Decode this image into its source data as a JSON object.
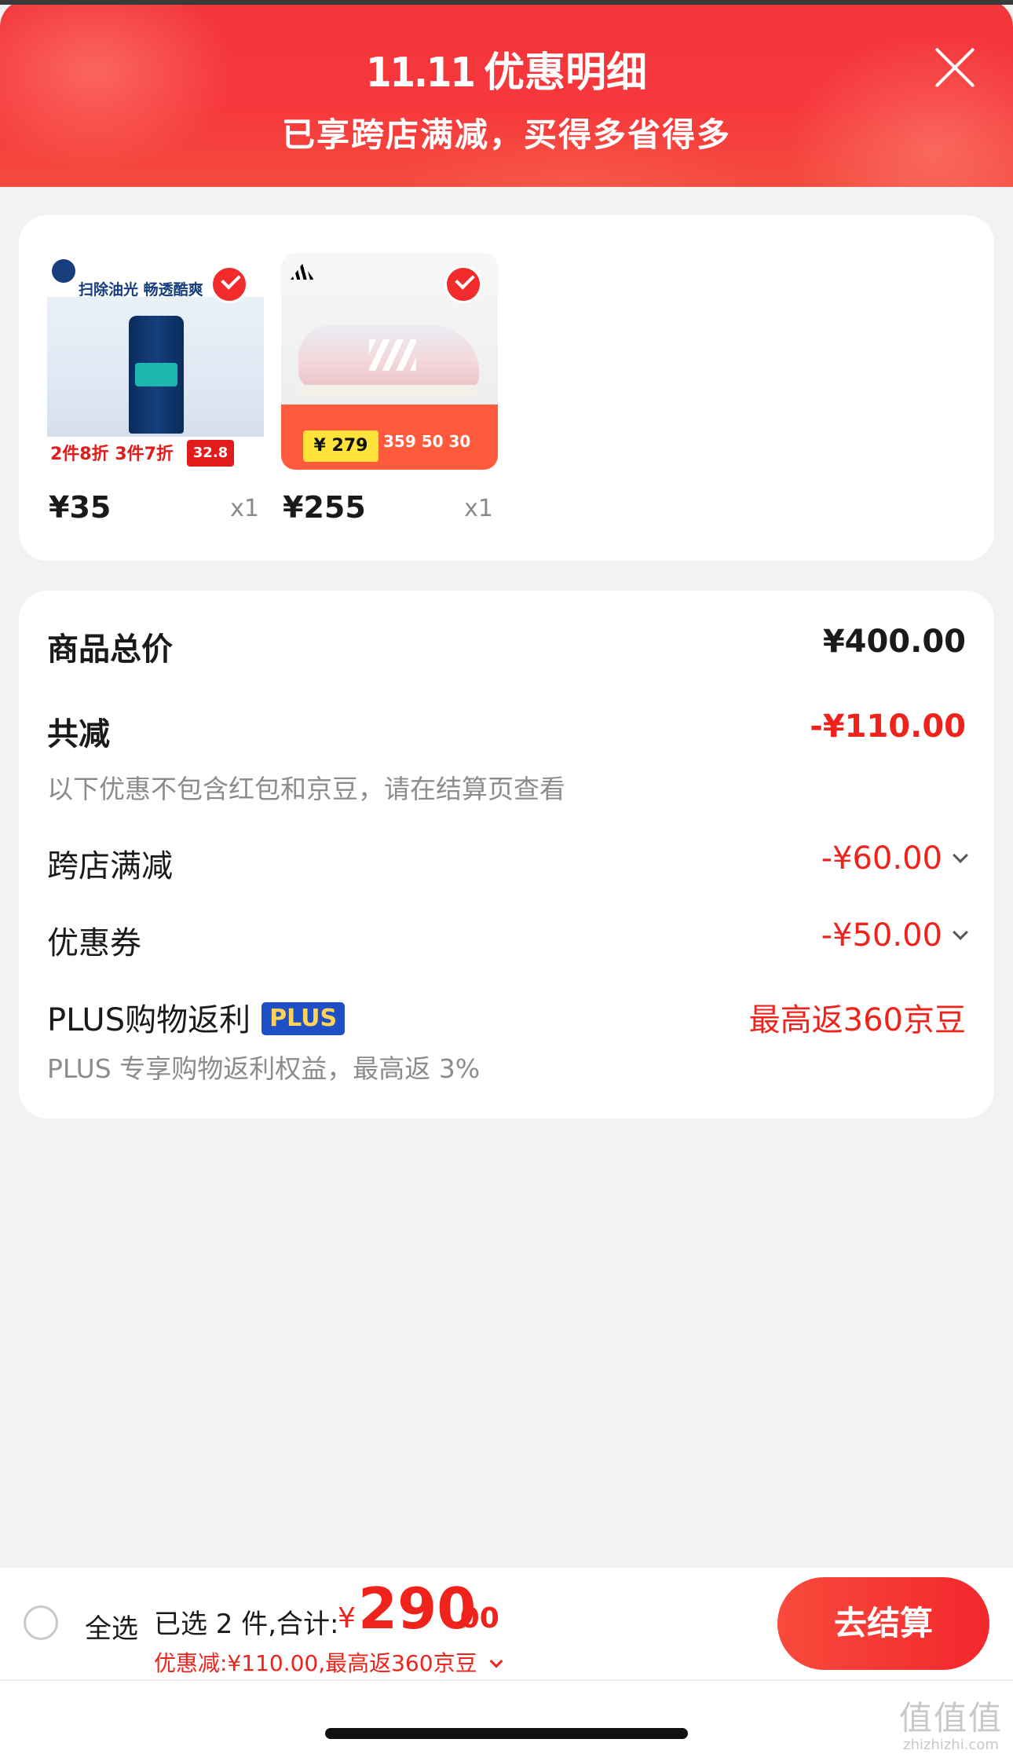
{
  "header": {
    "brand": "11.11",
    "title": "优惠明细",
    "subtitle": "已享跨店满减，买得多省得多"
  },
  "products": [
    {
      "price": "¥35",
      "qty": "x1",
      "image_slogan": "扫除油光 畅透酷爽",
      "image_promo": "2件8折 3件7折",
      "image_price": "32.8"
    },
    {
      "price": "¥255",
      "qty": "x1",
      "image_promo": "¥ 279",
      "image_nums": "359  50  30"
    }
  ],
  "summary": {
    "total_label": "商品总价",
    "total_value": "¥400.00",
    "reduce_label": "共减",
    "reduce_value": "-¥110.00",
    "reduce_note": "以下优惠不包含红包和京豆，请在结算页查看",
    "cross_store_label": "跨店满减",
    "cross_store_value": "-¥60.00",
    "coupon_label": "优惠券",
    "coupon_value": "-¥50.00",
    "plus_label": "PLUS购物返利",
    "plus_badge": "PLUS",
    "plus_value": "最高返360京豆",
    "plus_note": "PLUS 专享购物返利权益，最高返 3%"
  },
  "bottom": {
    "select_all": "全选",
    "selected": "已选 2 件,合计:",
    "currency": "¥",
    "total_int": "290",
    "total_dec": ".00",
    "discount": "优惠减:¥110.00,最高返360京豆",
    "checkout": "去结算"
  },
  "watermark": {
    "cn": "值值值",
    "url": "zhizhizhi.com"
  },
  "colors": {
    "accent_red": "#f0231c",
    "header_red": "#f6383c",
    "plus_blue": "#1f4fc4"
  },
  "icons": [
    "close-icon",
    "check-icon",
    "chevron-down-icon",
    "radio-icon"
  ]
}
